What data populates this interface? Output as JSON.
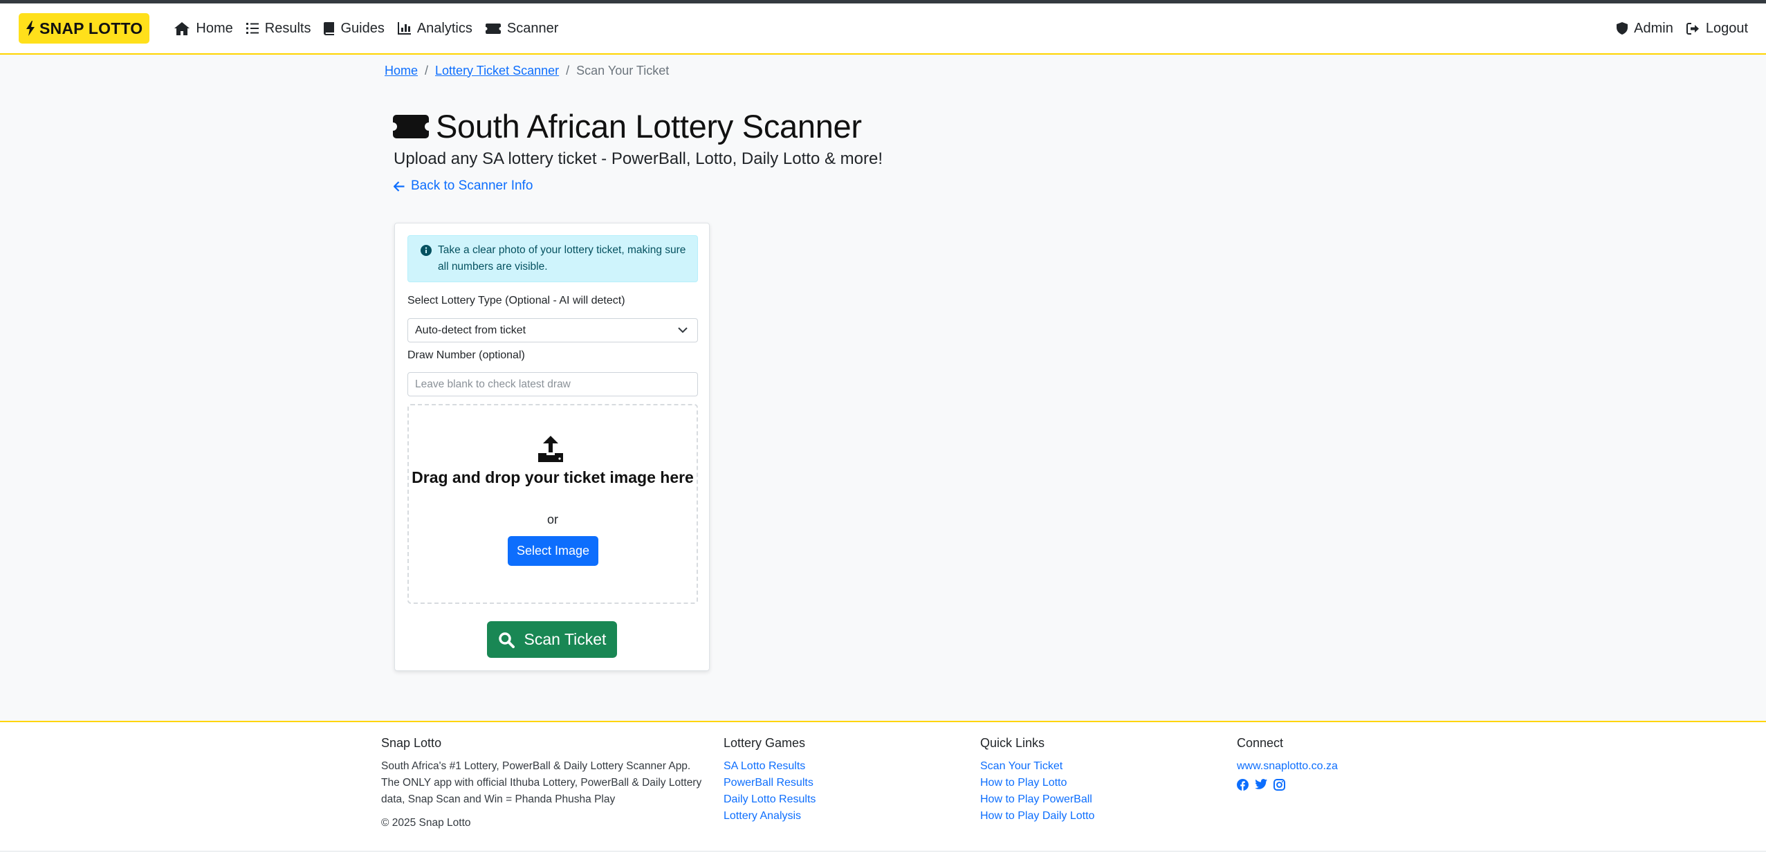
{
  "nav": {
    "brand": "SNAP LOTTO",
    "links": [
      {
        "label": "Home",
        "icon": "home-icon"
      },
      {
        "label": "Results",
        "icon": "list-ol-icon"
      },
      {
        "label": "Guides",
        "icon": "book-icon"
      },
      {
        "label": "Analytics",
        "icon": "chart-bar-icon"
      },
      {
        "label": "Scanner",
        "icon": "ticket-icon"
      }
    ],
    "right": [
      {
        "label": "Admin",
        "icon": "shield-icon"
      },
      {
        "label": "Logout",
        "icon": "logout-icon"
      }
    ]
  },
  "breadcrumb": {
    "home": "Home",
    "scanner": "Lottery Ticket Scanner",
    "sep": "/",
    "current": "Scan Your Ticket"
  },
  "page": {
    "title": "South African Lottery Scanner",
    "subtitle": "Upload any SA lottery ticket - PowerBall, Lotto, Daily Lotto & more!",
    "back_link": "Back to Scanner Info"
  },
  "form": {
    "alert": "Take a clear photo of your lottery ticket, making sure all numbers are visible.",
    "lottery_type_label": "Select Lottery Type (Optional - AI will detect)",
    "lottery_type_value": "Auto-detect from ticket",
    "draw_label": "Draw Number (optional)",
    "draw_placeholder": "Leave blank to check latest draw",
    "dropzone_title": "Drag and drop your ticket image here",
    "dropzone_or": "or",
    "select_image": "Select Image",
    "scan_button": "Scan Ticket"
  },
  "footer": {
    "about_title": "Snap Lotto",
    "about_text": "South Africa's #1 Lottery, PowerBall & Daily Lottery Scanner App. The ONLY app with official Ithuba Lottery, PowerBall & Daily Lottery data, Snap Scan and Win = Phanda Phusha Play",
    "copyright": "© 2025 Snap Lotto",
    "games_title": "Lottery Games",
    "games": [
      "SA Lotto Results",
      "PowerBall Results",
      "Daily Lotto Results",
      "Lottery Analysis"
    ],
    "quick_title": "Quick Links",
    "quick": [
      "Scan Your Ticket",
      "How to Play Lotto",
      "How to Play PowerBall",
      "How to Play Daily Lotto"
    ],
    "connect_title": "Connect",
    "website": "www.snaplotto.co.za",
    "socials": [
      "facebook-icon",
      "twitter-icon",
      "instagram-icon"
    ]
  },
  "colors": {
    "brand_yellow": "#ffe01b",
    "primary": "#0d6efd",
    "success": "#198754",
    "info_bg": "#cff4fc"
  }
}
